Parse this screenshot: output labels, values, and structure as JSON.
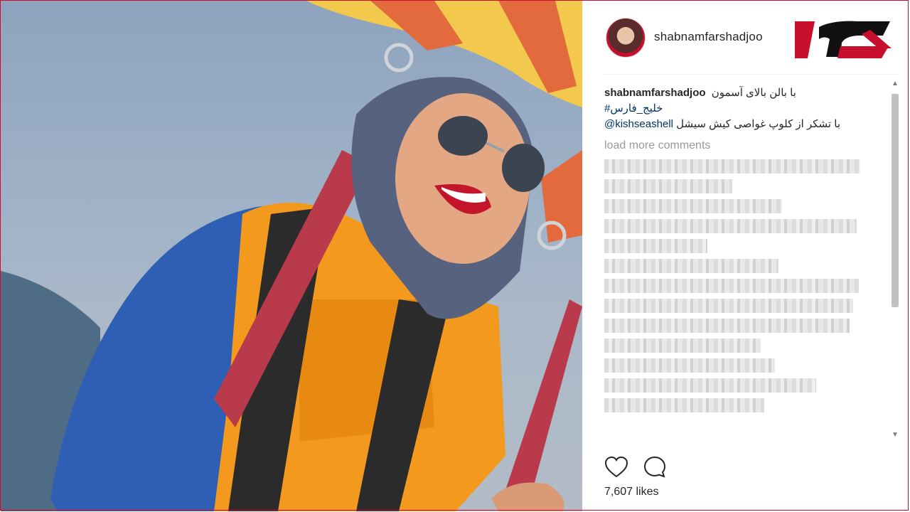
{
  "post": {
    "username": "shabnamfarshadjoo",
    "caption_username": "shabnamfarshadjoo",
    "caption_text": "با بالن بالای آسمون",
    "hashtag": "#خلیج_فارس",
    "mention": "@kishseashell",
    "mention_text": "با تشکر از کلوپ غواصی کیش سیشل",
    "load_more": "load more comments",
    "likes": "7,607 likes"
  },
  "icons": {
    "like": "heart-icon",
    "comment": "comment-icon",
    "avatar": "profile-avatar",
    "logo": "brand-logo"
  },
  "colors": {
    "brand_red": "#c8102e",
    "link": "#003569",
    "muted": "#999999"
  },
  "blurred_comments_count_visible": 13
}
